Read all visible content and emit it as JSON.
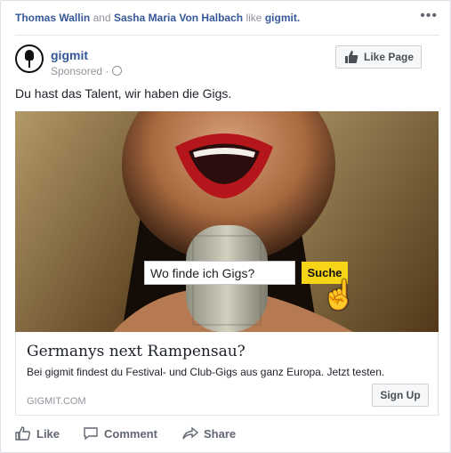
{
  "social_context": {
    "user1": "Thomas Wallin",
    "conjunction": "and",
    "user2": "Sasha Maria Von Halbach",
    "verb": "like",
    "page": "gigmit."
  },
  "post": {
    "page_name": "gigmit",
    "sponsored_label": "Sponsored ·",
    "like_page_label": "Like Page",
    "text": "Du hast das Talent, wir haben die Gigs."
  },
  "ad_image": {
    "search_text": "Wo finde ich Gigs?",
    "search_button": "Suche"
  },
  "link": {
    "headline": "Germanys next Rampensau?",
    "description": "Bei gigmit findest du Festival- und Club-Gigs aus ganz Europa. Jetzt testen.",
    "domain": "GIGMIT.COM",
    "cta": "Sign Up"
  },
  "actions": {
    "like": "Like",
    "comment": "Comment",
    "share": "Share"
  },
  "colors": {
    "link_blue": "#365899",
    "button_yellow": "#f7d417",
    "lips_red": "#b5161b"
  }
}
